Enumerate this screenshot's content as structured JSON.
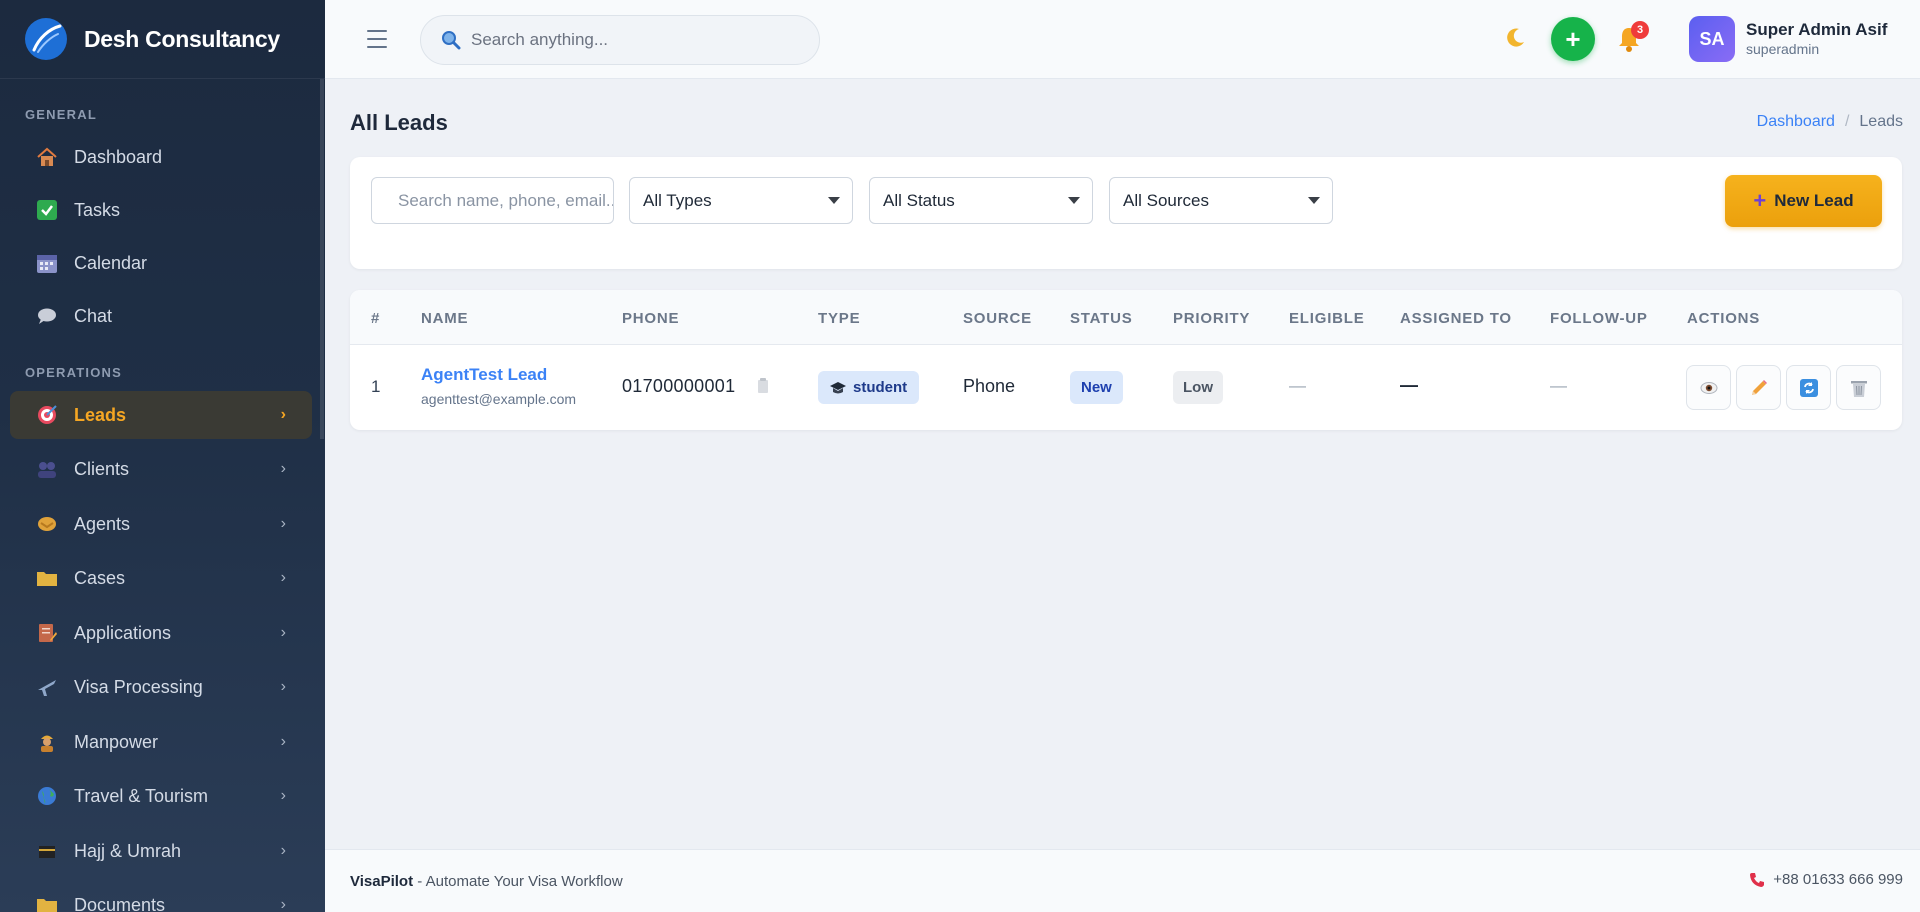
{
  "brand": {
    "name": "Desh Consultancy"
  },
  "sidebar": {
    "general_label": "GENERAL",
    "operations_label": "OPERATIONS",
    "general": [
      {
        "label": "Dashboard",
        "icon": "house-icon"
      },
      {
        "label": "Tasks",
        "icon": "checkbox-icon"
      },
      {
        "label": "Calendar",
        "icon": "calendar-icon"
      },
      {
        "label": "Chat",
        "icon": "chat-bubble-icon"
      }
    ],
    "operations": [
      {
        "label": "Leads",
        "icon": "target-icon",
        "active": true
      },
      {
        "label": "Clients",
        "icon": "people-icon"
      },
      {
        "label": "Agents",
        "icon": "handshake-icon"
      },
      {
        "label": "Cases",
        "icon": "folder-icon"
      },
      {
        "label": "Applications",
        "icon": "document-pen-icon"
      },
      {
        "label": "Visa Processing",
        "icon": "airplane-icon"
      },
      {
        "label": "Manpower",
        "icon": "worker-icon"
      },
      {
        "label": "Travel & Tourism",
        "icon": "globe-icon"
      },
      {
        "label": "Hajj & Umrah",
        "icon": "kaaba-icon"
      },
      {
        "label": "Documents",
        "icon": "folder-icon"
      }
    ],
    "chevron": "›"
  },
  "topbar": {
    "search_placeholder": "Search anything...",
    "add_label": "+",
    "notification_count": "3",
    "user": {
      "initials": "SA",
      "name": "Super Admin Asif",
      "role": "superadmin"
    }
  },
  "page": {
    "title": "All Leads",
    "breadcrumb": {
      "home": "Dashboard",
      "separator": "/",
      "current": "Leads"
    }
  },
  "filters": {
    "search_placeholder": "Search name, phone, email...",
    "type": "All Types",
    "status": "All Status",
    "source": "All Sources",
    "new_button": "New Lead"
  },
  "table": {
    "columns": [
      "#",
      "NAME",
      "PHONE",
      "TYPE",
      "SOURCE",
      "STATUS",
      "PRIORITY",
      "ELIGIBLE",
      "ASSIGNED TO",
      "FOLLOW-UP",
      "ACTIONS"
    ],
    "rows": [
      {
        "index": "1",
        "name": "AgentTest Lead",
        "email": "agenttest@example.com",
        "phone": "01700000001",
        "type": "student",
        "source": "Phone",
        "status": "New",
        "priority": "Low",
        "eligible": "—",
        "assigned_to": "—",
        "follow_up": "—"
      }
    ]
  },
  "footer": {
    "brand": "VisaPilot",
    "tagline": " - Automate Your Visa Workflow",
    "phone": "+88 01633 666 999"
  },
  "colors": {
    "accent": "#f5a623",
    "link": "#3b82f6",
    "success": "#16b34a",
    "danger": "#ef3b3b",
    "sidebar": "#1f2f46"
  }
}
